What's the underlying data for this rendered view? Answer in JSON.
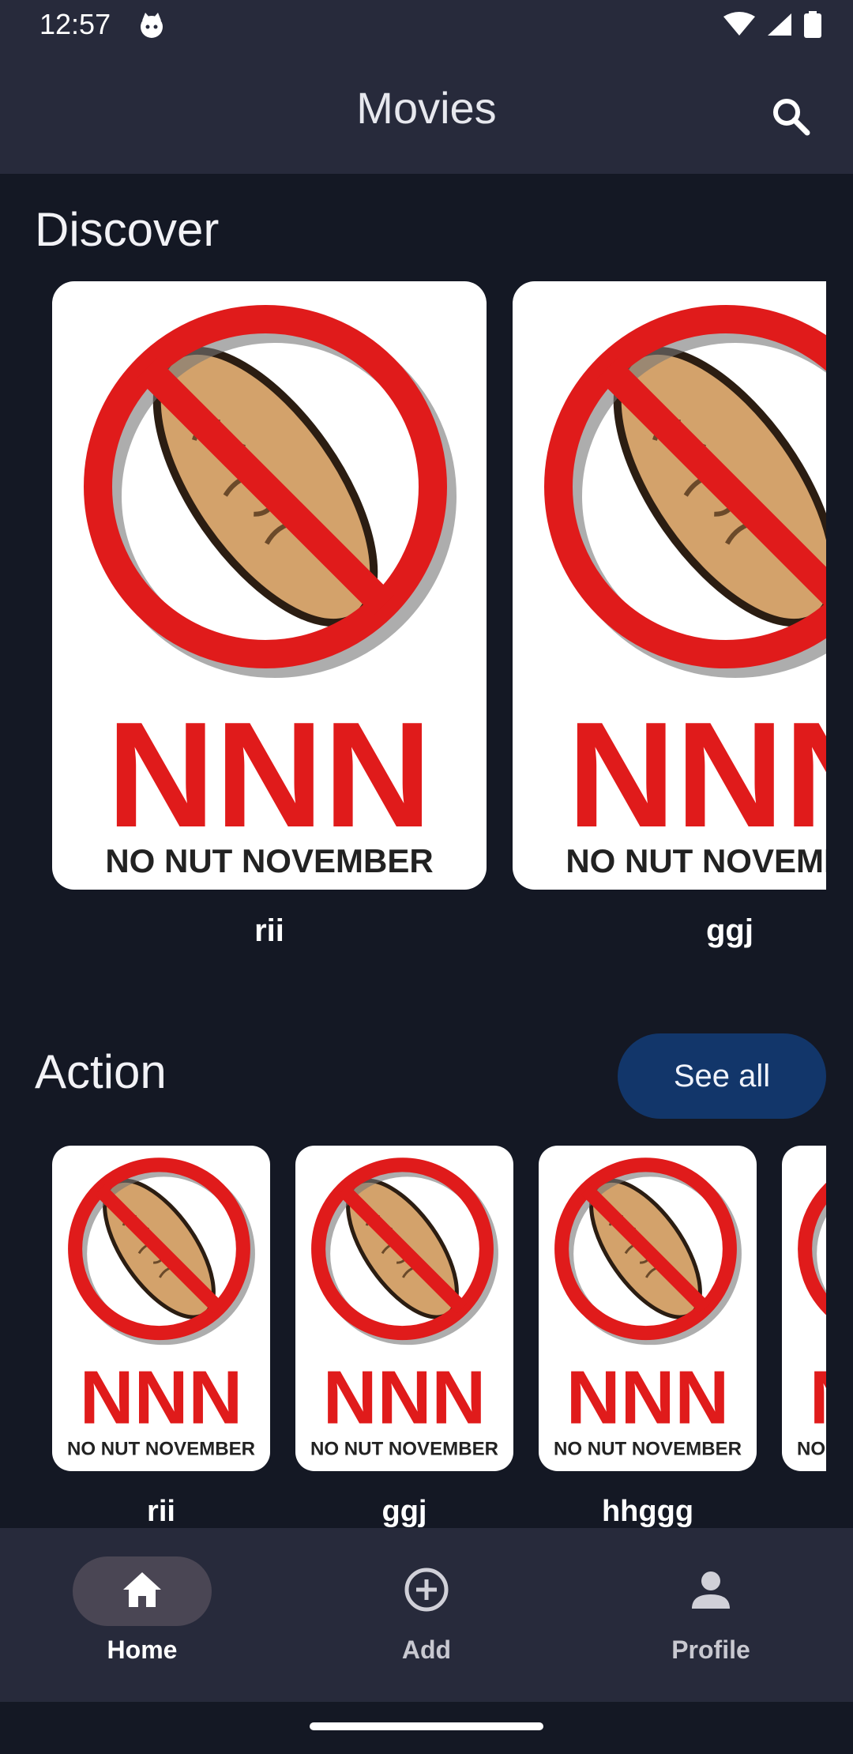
{
  "status": {
    "time": "12:57",
    "icons": [
      "cat-face-icon",
      "wifi-icon",
      "signal-icon",
      "battery-icon"
    ]
  },
  "appbar": {
    "title": "Movies",
    "search_icon": "search-icon"
  },
  "discover": {
    "title": "Discover",
    "items": [
      {
        "title": "rii",
        "poster_top": "NNN",
        "poster_bottom": "NO NUT NOVEMBER"
      },
      {
        "title": "ggj",
        "poster_top": "NNN",
        "poster_bottom": "NO NUT NOVEMBER"
      }
    ]
  },
  "action": {
    "title": "Action",
    "see_all": "See all",
    "items": [
      {
        "title": "rii",
        "poster_top": "NNN",
        "poster_bottom": "NO NUT NOVEMBER"
      },
      {
        "title": "ggj",
        "poster_top": "NNN",
        "poster_bottom": "NO NUT NOVEMBER"
      },
      {
        "title": "hhggg",
        "poster_top": "NNN",
        "poster_bottom": "NO NUT NOVEMBER"
      },
      {
        "title": "",
        "poster_top": "NNN",
        "poster_bottom": "NO NUT NOVEMBER"
      }
    ]
  },
  "nav": {
    "items": [
      {
        "label": "Home",
        "icon": "home-icon",
        "active": true
      },
      {
        "label": "Add",
        "icon": "add-circle-icon",
        "active": false
      },
      {
        "label": "Profile",
        "icon": "person-icon",
        "active": false
      }
    ]
  },
  "colors": {
    "accent": "#12366a",
    "poster_red": "#e01b1b",
    "peanut": "#d3a26b"
  }
}
